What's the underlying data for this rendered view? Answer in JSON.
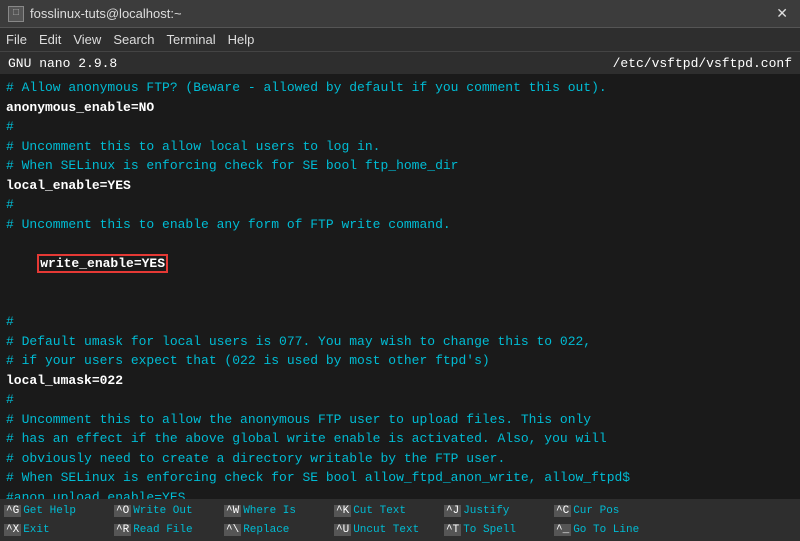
{
  "titlebar": {
    "title": "fosslinux-tuts@localhost:~",
    "close_label": "✕",
    "icon_label": "□"
  },
  "menubar": {
    "items": [
      "File",
      "Edit",
      "View",
      "Search",
      "Terminal",
      "Help"
    ]
  },
  "nanoheader": {
    "version": "GNU nano 2.9.8",
    "filepath": "/etc/vsftpd/vsftpd.conf"
  },
  "content": {
    "lines": [
      {
        "text": "# Allow anonymous FTP? (Beware - allowed by default if you comment this out).",
        "type": "comment"
      },
      {
        "text": "anonymous_enable=NO",
        "type": "setting"
      },
      {
        "text": "#",
        "type": "blank"
      },
      {
        "text": "# Uncomment this to allow local users to log in.",
        "type": "comment"
      },
      {
        "text": "# When SELinux is enforcing check for SE bool ftp_home_dir",
        "type": "comment"
      },
      {
        "text": "local_enable=YES",
        "type": "setting"
      },
      {
        "text": "#",
        "type": "blank"
      },
      {
        "text": "# Uncomment this to enable any form of FTP write command.",
        "type": "comment"
      },
      {
        "text": "write_enable=YES",
        "type": "highlighted"
      },
      {
        "text": "",
        "type": "blank"
      },
      {
        "text": "#",
        "type": "blank"
      },
      {
        "text": "# Default umask for local users is 077. You may wish to change this to 022,",
        "type": "comment"
      },
      {
        "text": "# if your users expect that (022 is used by most other ftpd's)",
        "type": "comment"
      },
      {
        "text": "local_umask=022",
        "type": "setting"
      },
      {
        "text": "#",
        "type": "blank"
      },
      {
        "text": "# Uncomment this to allow the anonymous FTP user to upload files. This only",
        "type": "comment"
      },
      {
        "text": "# has an effect if the above global write enable is activated. Also, you will",
        "type": "comment"
      },
      {
        "text": "# obviously need to create a directory writable by the FTP user.",
        "type": "comment"
      },
      {
        "text": "# When SELinux is enforcing check for SE bool allow_ftpd_anon_write, allow_ftpd$",
        "type": "comment"
      },
      {
        "text": "#anon_upload_enable=YES",
        "type": "comment"
      }
    ]
  },
  "footer": {
    "rows": [
      [
        {
          "key": "^G",
          "label": "Get Help"
        },
        {
          "key": "^O",
          "label": "Write Out"
        },
        {
          "key": "^W",
          "label": "Where Is"
        },
        {
          "key": "^K",
          "label": "Cut Text"
        },
        {
          "key": "^J",
          "label": "Justify"
        },
        {
          "key": "^C",
          "label": "Cur Pos"
        }
      ],
      [
        {
          "key": "^X",
          "label": "Exit"
        },
        {
          "key": "^R",
          "label": "Read File"
        },
        {
          "key": "^\\",
          "label": "Replace"
        },
        {
          "key": "^U",
          "label": "Uncut Text"
        },
        {
          "key": "^T",
          "label": "To Spell"
        },
        {
          "key": "^_",
          "label": "Go To Line"
        }
      ]
    ]
  }
}
